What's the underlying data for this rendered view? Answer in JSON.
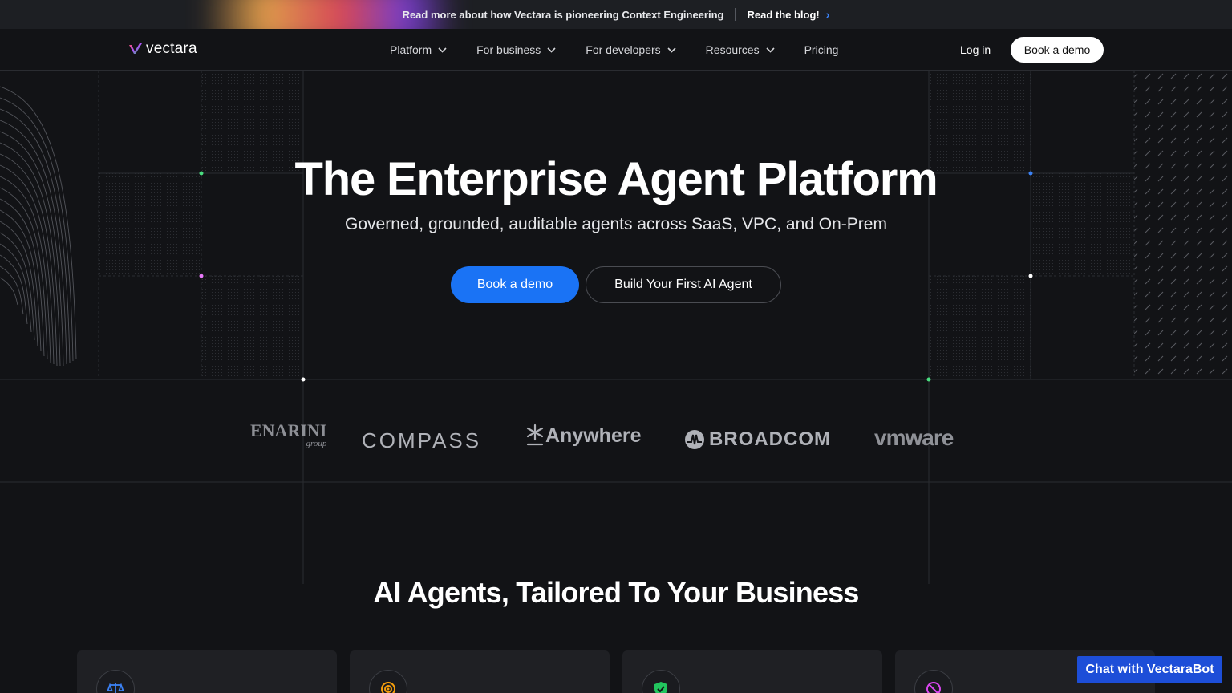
{
  "announcement": {
    "message": "Read more about how Vectara is pioneering Context Engineering",
    "link_label": "Read the blog!"
  },
  "nav": {
    "brand": "vectara",
    "menu": [
      {
        "label": "Platform",
        "has_dropdown": true
      },
      {
        "label": "For business",
        "has_dropdown": true
      },
      {
        "label": "For developers",
        "has_dropdown": true
      },
      {
        "label": "Resources",
        "has_dropdown": true
      },
      {
        "label": "Pricing",
        "has_dropdown": false
      }
    ],
    "login_label": "Log in",
    "demo_label": "Book a demo"
  },
  "hero": {
    "title": "The Enterprise Agent Platform",
    "subtitle": "Governed, grounded, auditable agents across SaaS, VPC, and On-Prem",
    "primary_cta": "Book a demo",
    "secondary_cta": "Build Your First AI Agent"
  },
  "customer_logos": {
    "menarini": "ENARINI",
    "menarini_sub": "group",
    "compass": "COMPASS",
    "anywhere": "Anywhere",
    "broadcom": "BROADCOM",
    "vmware": "vmware"
  },
  "features": {
    "title": "AI Agents, Tailored To Your Business",
    "cards": [
      {
        "icon": "scales-icon",
        "color": "#3b82f6"
      },
      {
        "icon": "target-icon",
        "color": "#f59e0b"
      },
      {
        "icon": "shield-check-icon",
        "color": "#22c55e"
      },
      {
        "icon": "no-hallucination-icon",
        "color": "#d946ef"
      }
    ]
  },
  "chat_widget": {
    "label": "Chat with VectaraBot"
  },
  "colors": {
    "accent": "#1a73f5",
    "background": "#121316"
  }
}
